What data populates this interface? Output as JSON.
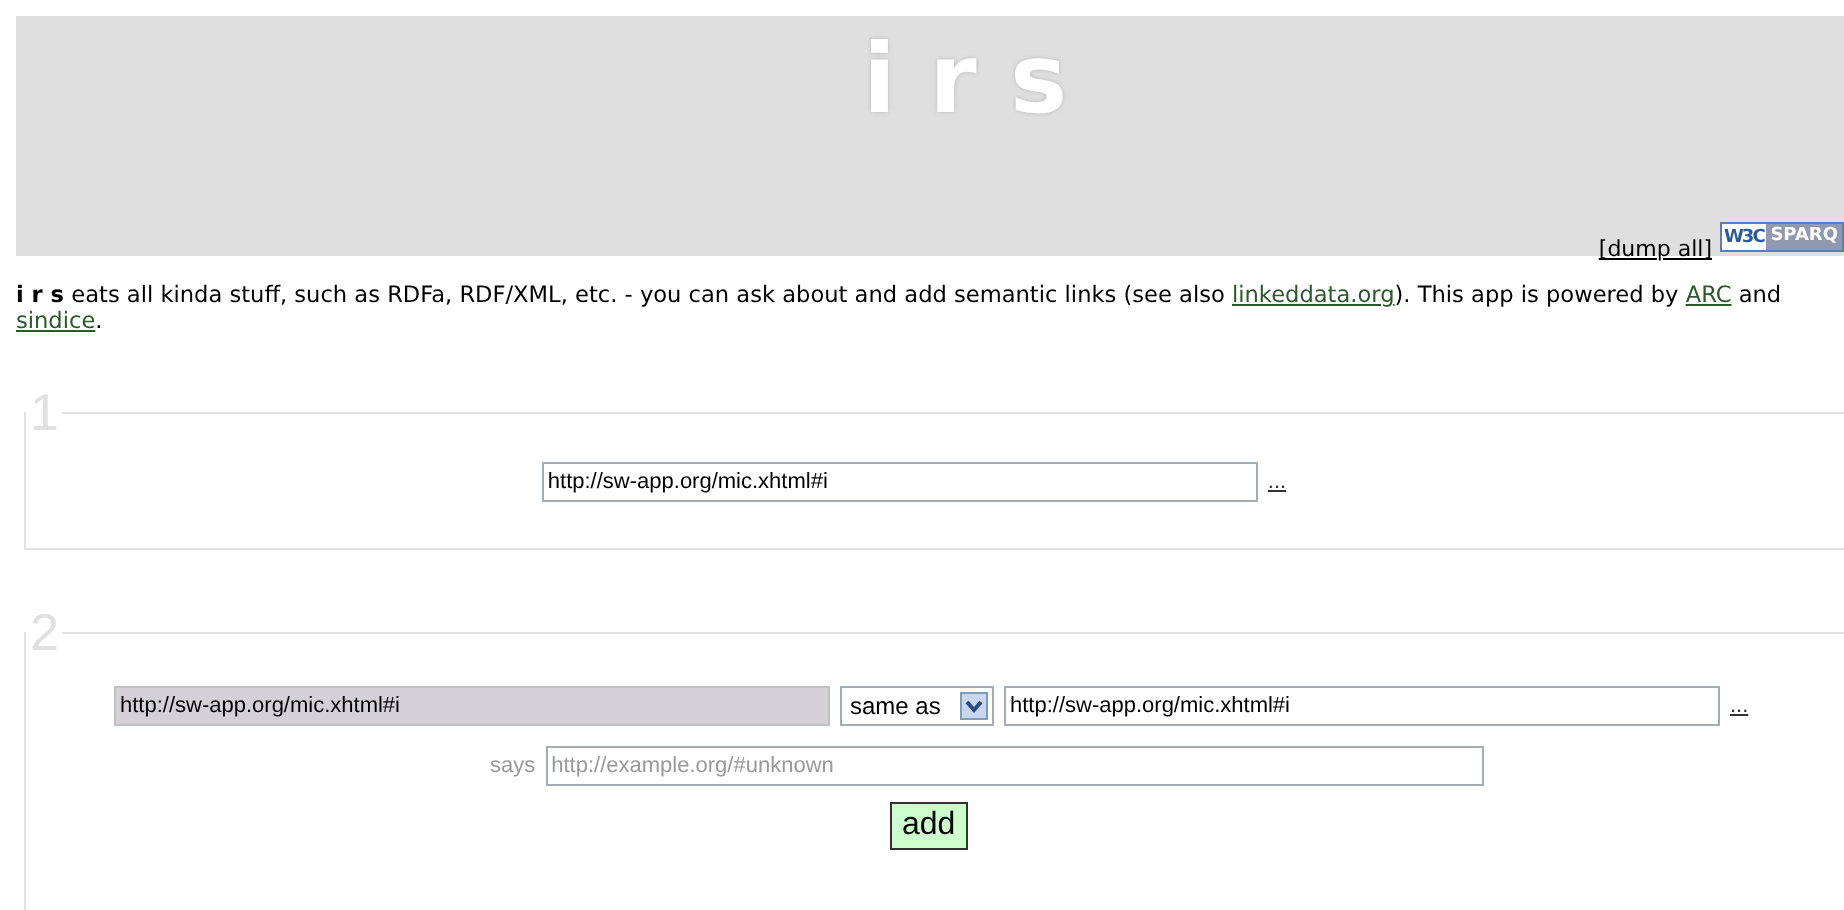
{
  "header": {
    "title": "i r s",
    "dump_link": "[dump all]",
    "badge": {
      "left": "W3C",
      "right": "SPARQ"
    }
  },
  "intro": [
    {
      "kind": "bold",
      "text": "i r s"
    },
    {
      "kind": "text",
      "text": " eats all kinda stuff, such as RDFa, RDF/XML, etc. - you can ask about and add semantic links (see also "
    },
    {
      "kind": "link",
      "text": "linkeddata.org"
    },
    {
      "kind": "text",
      "text": "). This app is powered by "
    },
    {
      "kind": "link",
      "text": "ARC"
    },
    {
      "kind": "text",
      "text": " and "
    },
    {
      "kind": "link",
      "text": "sindice"
    },
    {
      "kind": "text",
      "text": "."
    }
  ],
  "step1": {
    "legend": "1",
    "uri": {
      "value": "http://sw-app.org/mic.xhtml#i"
    },
    "more": "..."
  },
  "step2": {
    "legend": "2",
    "subject": {
      "value": "http://sw-app.org/mic.xhtml#i",
      "disabled": true
    },
    "relation": {
      "value": "same as"
    },
    "object": {
      "value": "http://sw-app.org/mic.xhtml#i"
    },
    "more": "...",
    "says_label": "says",
    "source": {
      "placeholder": "http://example.org/#unknown"
    },
    "add_button": "add"
  }
}
